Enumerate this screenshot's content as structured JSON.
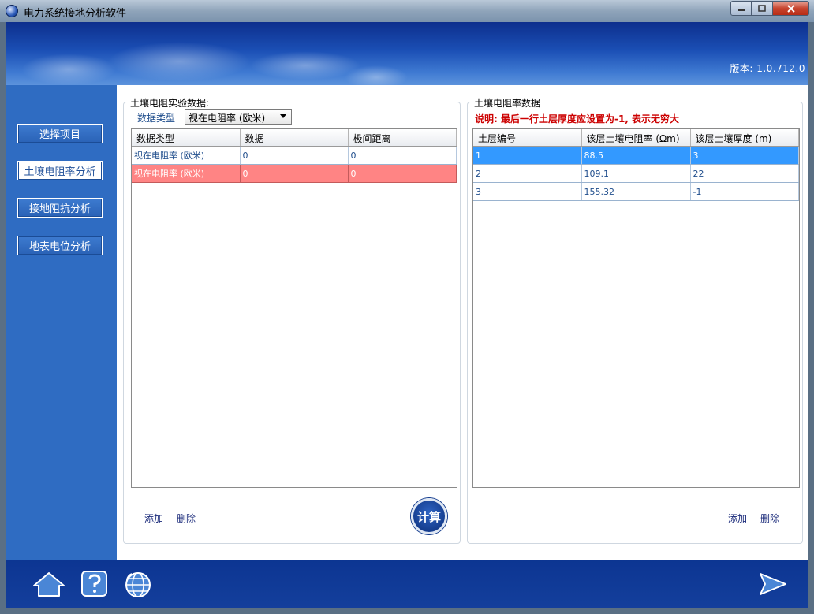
{
  "window": {
    "title": "电力系统接地分析软件"
  },
  "header": {
    "version": "版本: 1.0.712.0"
  },
  "nav": [
    {
      "label": "选择项目",
      "active": false
    },
    {
      "label": "土壤电阻率分析",
      "active": true
    },
    {
      "label": "接地阻抗分析",
      "active": false
    },
    {
      "label": "地表电位分析",
      "active": false
    }
  ],
  "left_panel": {
    "title": "土壤电阻实验数据:",
    "dtype_label": "数据类型",
    "dtype_value": "视在电阻率 (欧米)",
    "columns": [
      "数据类型",
      "数据",
      "极间距离"
    ],
    "rows": [
      [
        "视在电阻率 (欧米)",
        "0",
        "0"
      ],
      [
        "视在电阻率 (欧米)",
        "0",
        "0"
      ]
    ],
    "add": "添加",
    "delete": "删除",
    "calc": "计算"
  },
  "right_panel": {
    "title": "土壤电阻率数据",
    "note": "说明: 最后一行土层厚度应设置为-1, 表示无穷大",
    "columns": [
      "土层编号",
      "该层土壤电阻率 (Ωm)",
      "该层土壤厚度 (m)"
    ],
    "rows": [
      [
        "1",
        "88.5",
        "3"
      ],
      [
        "2",
        "109.1",
        "22"
      ],
      [
        "3",
        "155.32",
        "-1"
      ]
    ],
    "add": "添加",
    "delete": "删除"
  },
  "footer": {
    "icons": [
      "home-icon",
      "help-icon",
      "globe-icon",
      "next-arrow-icon"
    ]
  },
  "colors": {
    "selected_row": "#3399ff",
    "warning_row": "#ff8484",
    "nav_bg": "#2f6cc2",
    "note_text": "#cc0000"
  }
}
